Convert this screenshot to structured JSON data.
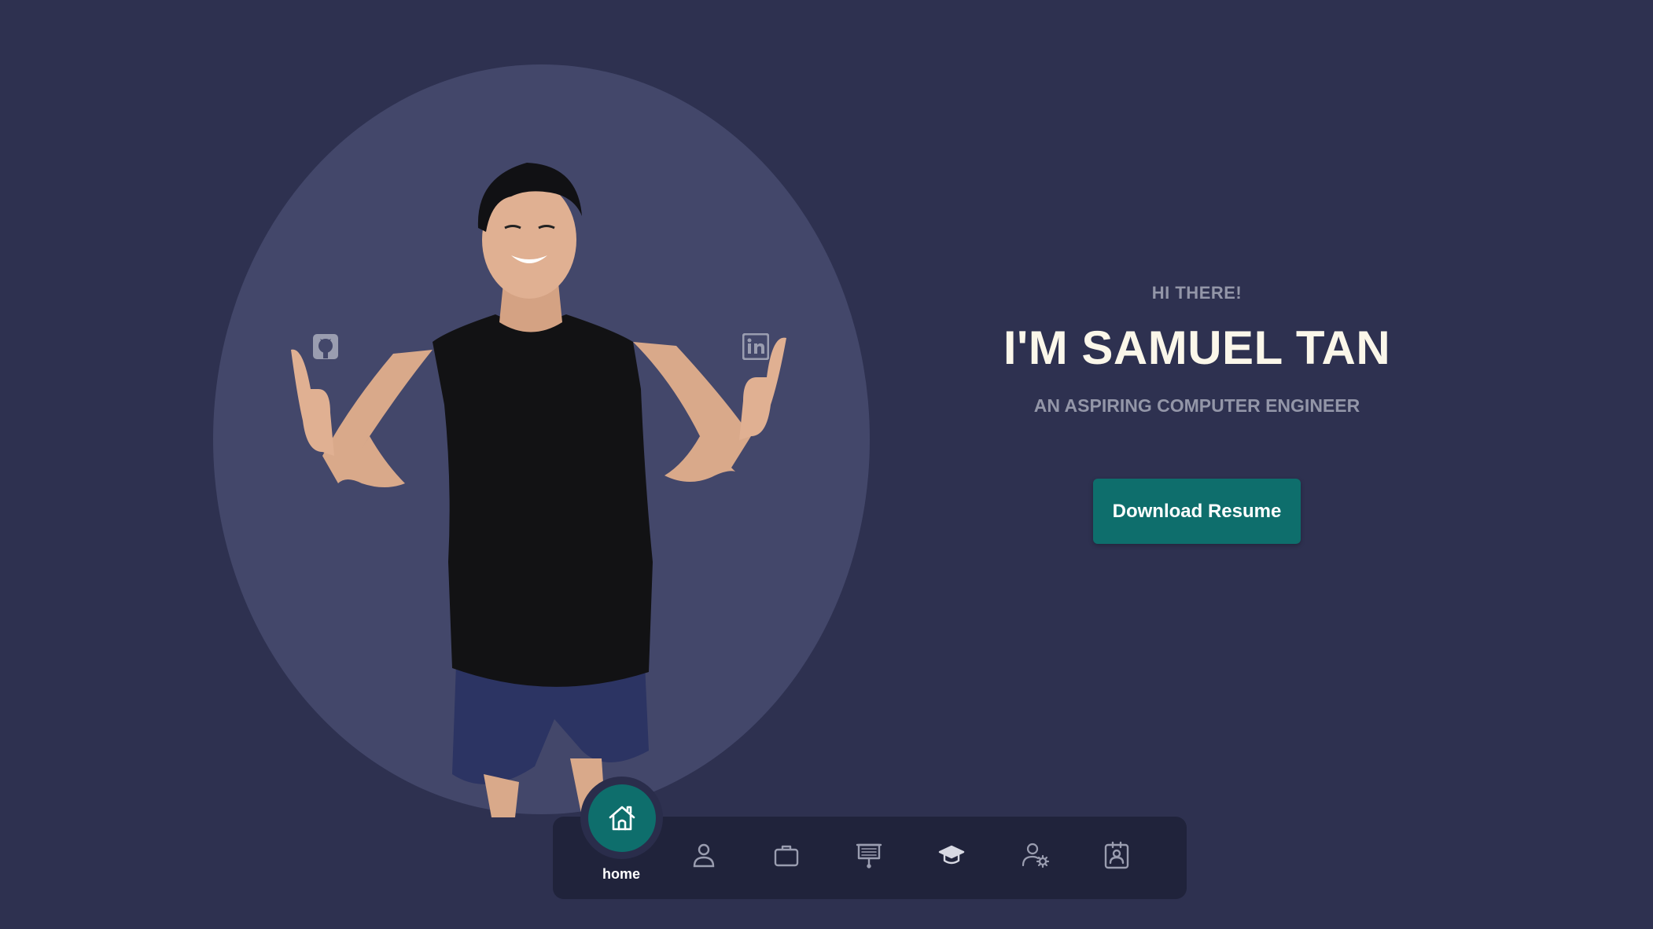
{
  "hero": {
    "greeting": "HI THERE!",
    "name": "I'M SAMUEL TAN",
    "tagline": "AN ASPIRING COMPUTER ENGINEER",
    "download_label": "Download Resume"
  },
  "social": {
    "github_icon": "github-icon",
    "linkedin_icon": "linkedin-icon"
  },
  "nav": {
    "active_label": "home",
    "items": [
      {
        "icon": "home-icon",
        "label": "home",
        "active": true
      },
      {
        "icon": "user-icon",
        "active": false
      },
      {
        "icon": "briefcase-icon",
        "active": false
      },
      {
        "icon": "presentation-icon",
        "active": false
      },
      {
        "icon": "graduation-cap-icon",
        "active": false
      },
      {
        "icon": "user-settings-icon",
        "active": false
      },
      {
        "icon": "contact-card-icon",
        "active": false
      }
    ]
  },
  "colors": {
    "background": "#2e3150",
    "oval": "#43476a",
    "accent": "#0e6e6c",
    "nav_bar": "#20233b",
    "name_text": "#fbf7ea",
    "muted_text": "#9396a8"
  }
}
